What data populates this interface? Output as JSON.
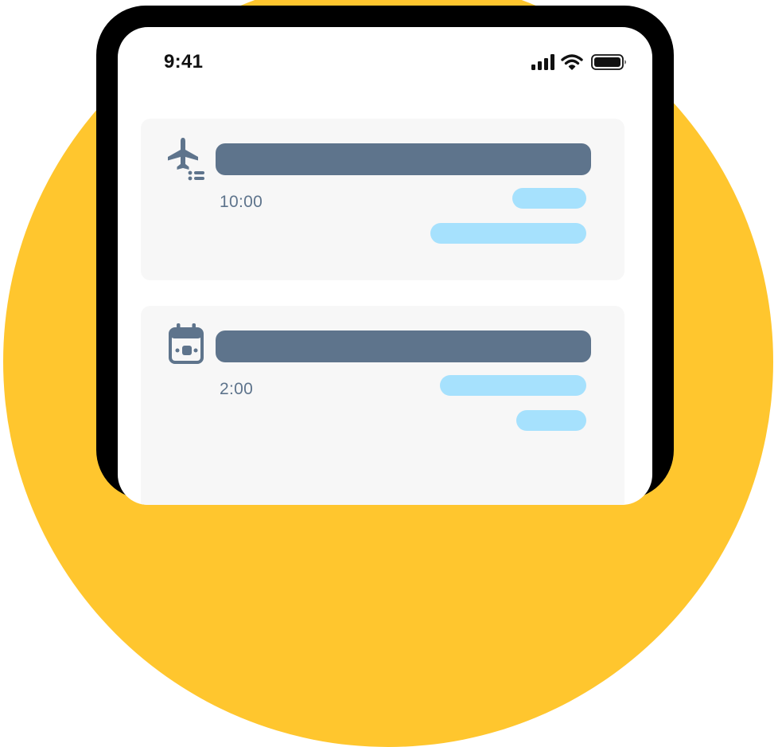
{
  "status_bar": {
    "time": "9:41",
    "icons": [
      "cellular-signal-icon",
      "wifi-icon",
      "battery-icon"
    ]
  },
  "cards": [
    {
      "icon": "airplane-departure-icon",
      "time": "10:00"
    },
    {
      "icon": "calendar-event-icon",
      "time": "2:00"
    }
  ],
  "colors": {
    "background_circle": "#FFC62E",
    "phone_frame": "#000000",
    "screen": "#FFFFFF",
    "card_background": "#F7F7F7",
    "title_placeholder": "#5E748C",
    "detail_placeholder": "#A6E1FD",
    "time_text": "#5E748C"
  }
}
